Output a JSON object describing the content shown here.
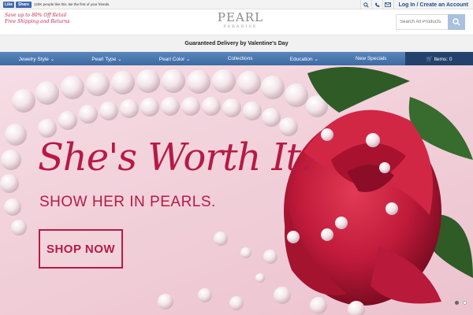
{
  "topbar": {
    "like_label": "Like",
    "share_label": "Share",
    "social_text": "120K people like this. Be the first of your friends.",
    "login_text": "Log In / Create an Account",
    "icons": [
      "search-icon",
      "phone-icon",
      "mail-icon"
    ]
  },
  "header": {
    "promo_line1": "Save up to 80% Off Retail",
    "promo_line2": "Free Shipping and Returns",
    "logo_main": "PEARL",
    "logo_sub": "PARADISE",
    "search_placeholder": "Search All Products"
  },
  "delivery_banner": "Guaranteed Delivery by Valentine's Day",
  "nav": {
    "items": [
      {
        "label": "Jewelry Style ⌄"
      },
      {
        "label": "Pearl Type ⌄"
      },
      {
        "label": "Pearl Color ⌄"
      },
      {
        "label": "Collections"
      },
      {
        "label": "Education ⌄"
      },
      {
        "label": "New Specials"
      }
    ],
    "cart_label": "🛒 Items: 0"
  },
  "hero": {
    "headline": "She's Worth It.",
    "subline": "SHOW HER IN PEARLS.",
    "button_label": "SHOP NOW",
    "slide_count": 2,
    "active_slide": 1
  },
  "colors": {
    "accent": "#b71a45",
    "nav_blue": "#4a76ae",
    "cart_navy": "#22426d",
    "promo_red": "#c3294b"
  }
}
